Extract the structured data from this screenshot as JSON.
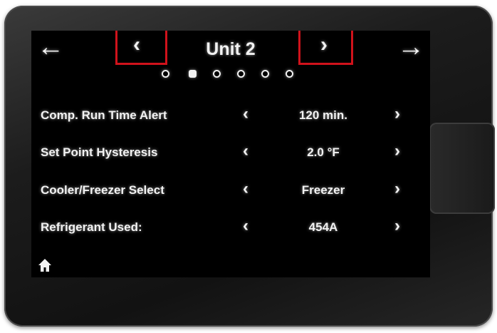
{
  "header": {
    "title": "Unit 2",
    "back_icon": "arrow-left-icon",
    "forward_icon": "arrow-right-icon",
    "prev_icon": "chevron-left-icon",
    "next_icon": "chevron-right-icon",
    "highlight_color": "#d0121b"
  },
  "pagination": {
    "total": 6,
    "active_index": 1
  },
  "settings": [
    {
      "label": "Comp. Run Time Alert",
      "value": "120 min."
    },
    {
      "label": "Set Point Hysteresis",
      "value": "2.0 °F"
    },
    {
      "label": "Cooler/Freezer Select",
      "value": "Freezer"
    },
    {
      "label": "Refrigerant Used:",
      "value": "454A"
    }
  ],
  "footer": {
    "home_icon": "home-icon"
  }
}
